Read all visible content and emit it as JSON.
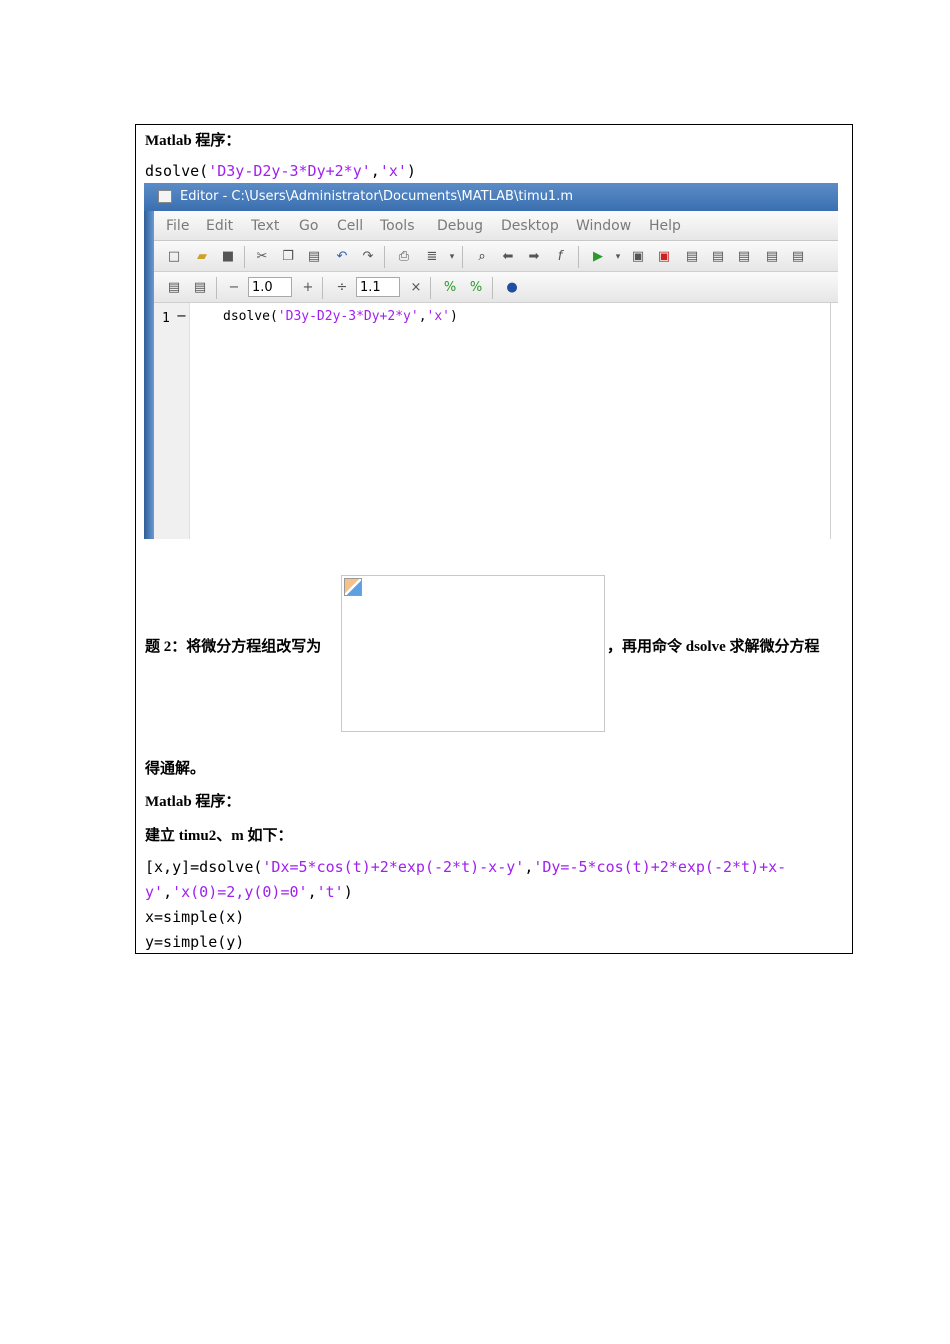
{
  "label_program1": "Matlab 程序：",
  "code1": {
    "prefix": "dsolve(",
    "arg1": "'D3y-D2y-3*Dy+2*y'",
    "comma": ",",
    "arg2": "'x'",
    "suffix": ")"
  },
  "editor": {
    "title": "Editor - C:\\Users\\Administrator\\Documents\\MATLAB\\timu1.m",
    "menu": [
      "File",
      "Edit",
      "Text",
      "Go",
      "Cell",
      "Tools",
      "Debug",
      "Desktop",
      "Window",
      "Help"
    ],
    "cell_field1": "1.0",
    "cell_field2": "1.1",
    "minus": "−",
    "plus": "+",
    "divide": "÷",
    "times": "×",
    "line_number": "1",
    "line_marker": "−",
    "code_prefix": "dsolve(",
    "code_arg1": "'D3y-D2y-3*Dy+2*y'",
    "code_comma": ",",
    "code_arg2": "'x'",
    "code_suffix": ")"
  },
  "question2_left": "题 2：将微分方程组改写为",
  "question2_right": "，再用命令 dsolve 求解微分方程",
  "question2_tail": "得通解。",
  "label_program2": "Matlab 程序：",
  "create_file": "建立 timu2、m 如下：",
  "code2": {
    "l1_prefix": "[x,y]=dsolve(",
    "l1_arg1": "'Dx=5*cos(t)+2*exp(-2*t)-x-y'",
    "l1_comma": ",",
    "l1_arg2a": "'Dy=-5*cos(t)+2*exp(-2*t)+x-",
    "l2_arg2b": "y'",
    "l2_comma1": ",",
    "l2_arg3": "'x(0)=2,y(0)=0'",
    "l2_comma2": ",",
    "l2_arg4": "'t'",
    "l2_suffix": ")",
    "l3": "x=simple(x)",
    "l4": "y=simple(y)"
  }
}
